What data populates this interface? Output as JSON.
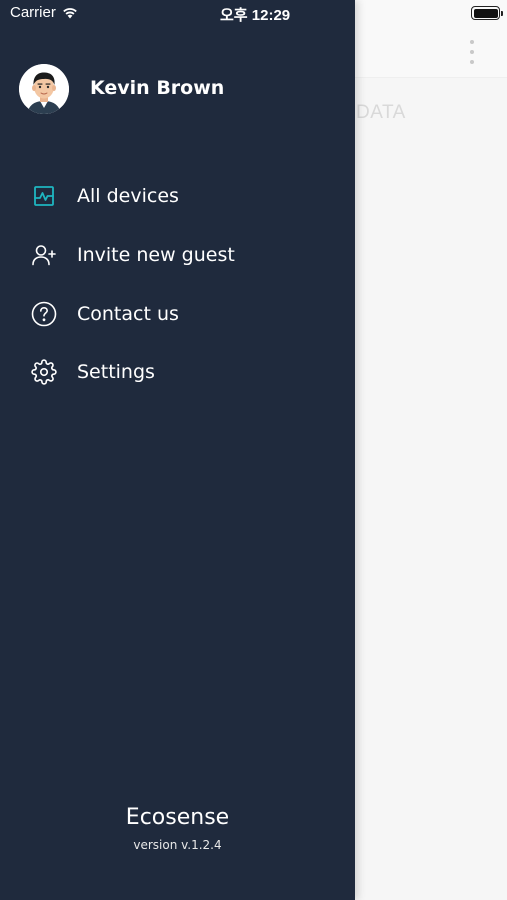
{
  "status_bar": {
    "carrier": "Carrier",
    "time": "오후 12:29"
  },
  "background_app": {
    "visible_text": "DATA",
    "menu_icon": "more-vertical-icon"
  },
  "drawer": {
    "user": {
      "name": "Kevin Brown",
      "avatar_icon": "avatar-man-icon"
    },
    "menu_items": [
      {
        "label": "All devices",
        "icon": "activity-chart-icon",
        "accent_color": "#1fb6c1"
      },
      {
        "label": "Invite new guest",
        "icon": "user-plus-icon"
      },
      {
        "label": "Contact us",
        "icon": "question-circle-icon"
      },
      {
        "label": "Settings",
        "icon": "gear-icon"
      }
    ],
    "brand": "Ecosense",
    "version": "version v.1.2.4",
    "colors": {
      "background": "#1f2a3d",
      "text": "#ffffff",
      "accent": "#1fb6c1"
    }
  }
}
